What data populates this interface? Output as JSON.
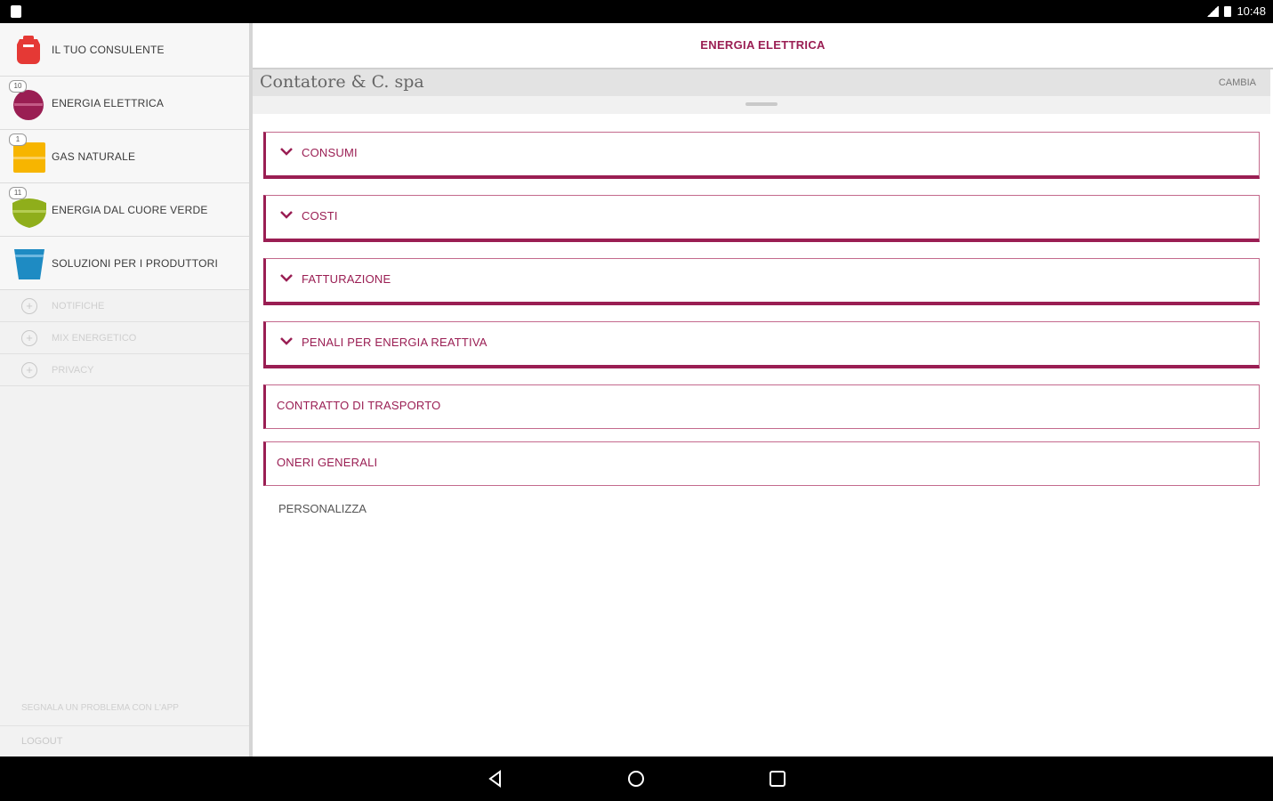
{
  "status_bar": {
    "time": "10:48"
  },
  "sidebar": {
    "main_items": [
      {
        "label": "IL TUO CONSULENTE",
        "icon": "consultant-icon",
        "color": "#e53935",
        "badge": ""
      },
      {
        "label": "ENERGIA ELETTRICA",
        "icon": "electricity-icon",
        "color": "#9a1e53",
        "badge": "10"
      },
      {
        "label": "GAS NATURALE",
        "icon": "gas-icon",
        "color": "#f7b500",
        "badge": "1"
      },
      {
        "label": "ENERGIA DAL CUORE VERDE",
        "icon": "green-energy-icon",
        "color": "#8fae1b",
        "badge": "11"
      },
      {
        "label": "SOLUZIONI PER I PRODUTTORI",
        "icon": "producers-icon",
        "color": "#1e8bc3",
        "badge": ""
      }
    ],
    "small_items": [
      {
        "label": "NOTIFICHE"
      },
      {
        "label": "MIX ENERGETICO"
      },
      {
        "label": "PRIVACY"
      }
    ],
    "report_problem": "SEGNALA UN PROBLEMA CON L'APP",
    "logout": "LOGOUT"
  },
  "header": {
    "title": "ENERGIA ELETTRICA"
  },
  "company": {
    "name": "Contatore & C. spa",
    "change_label": "CAMBIA"
  },
  "sections": [
    {
      "label": "CONSUMI",
      "expandable": true
    },
    {
      "label": "COSTI",
      "expandable": true
    },
    {
      "label": "FATTURAZIONE",
      "expandable": true
    },
    {
      "label": "PENALI PER ENERGIA REATTIVA",
      "expandable": true
    },
    {
      "label": "CONTRATTO DI TRASPORTO",
      "expandable": false
    },
    {
      "label": "ONERI GENERALI",
      "expandable": false
    }
  ],
  "personalize_label": "PERSONALIZZA",
  "colors": {
    "accent": "#9a1e53",
    "sidebar_bg": "#f2f2f2"
  }
}
